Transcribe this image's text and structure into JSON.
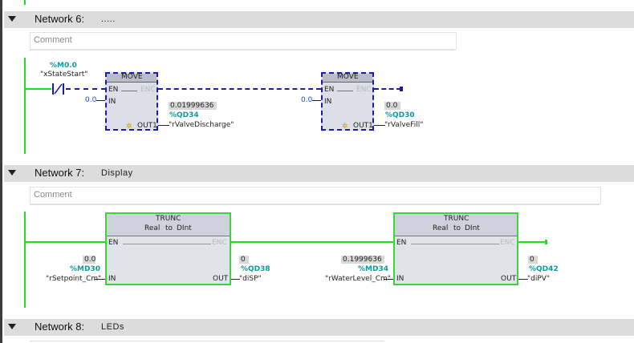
{
  "networks": [
    {
      "number": "Network 6:",
      "title": "....."
    },
    {
      "number": "Network 7:",
      "title": "Display"
    },
    {
      "number": "Network 8:",
      "title": "LEDs"
    }
  ],
  "comment_placeholder": "Comment",
  "net6": {
    "contact_addr": "%M0.0",
    "contact_tag": "\"xStateStart\"",
    "move1": {
      "name": "MOVE",
      "en": "EN",
      "enc": "ENC",
      "in": "IN",
      "out": "OUT1",
      "in_val": "0.0",
      "out_val": "0.01999636",
      "out_addr": "%QD34",
      "out_tag": "\"rValveDischarge\""
    },
    "move2": {
      "name": "MOVE",
      "en": "EN",
      "enc": "ENC",
      "in": "IN",
      "out": "OUT1",
      "in_val": "0.0",
      "out_val": "0.0",
      "out_addr": "%QD30",
      "out_tag": "\"rValveFill\""
    }
  },
  "net7": {
    "trunc1": {
      "name": "TRUNC",
      "type_from": "Real",
      "to": "to",
      "type_to": "DInt",
      "en": "EN",
      "enc": "ENC",
      "in": "IN",
      "out": "OUT",
      "in_val": "0.0",
      "in_addr": "%MD30",
      "in_tag": "\"rSetpoint_Cm\"",
      "out_val": "0",
      "out_addr": "%QD38",
      "out_tag": "\"diSP\""
    },
    "trunc2": {
      "name": "TRUNC",
      "type_from": "Real",
      "to": "to",
      "type_to": "DInt",
      "en": "EN",
      "enc": "ENC",
      "in": "IN",
      "out": "OUT",
      "in_val": "0.1999636",
      "in_addr": "%MD34",
      "in_tag": "\"rWaterLevel_Cm\"",
      "out_val": "0",
      "out_addr": "%QD42",
      "out_tag": "\"diPV\""
    }
  },
  "colors": {
    "power_on": "#22dd22",
    "power_off": "#1c1ca8",
    "address": "#0f9a9a"
  }
}
